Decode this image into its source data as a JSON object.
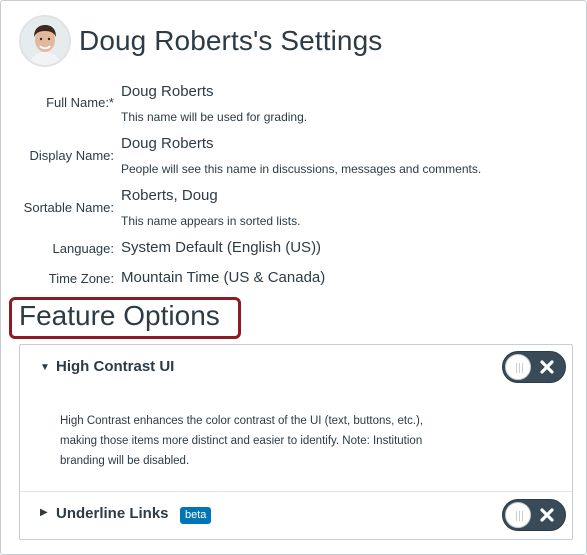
{
  "header": {
    "title": "Doug Roberts's Settings"
  },
  "profile": {
    "full_name": {
      "label": "Full Name:*",
      "value": "Doug Roberts",
      "hint": "This name will be used for grading."
    },
    "display_name": {
      "label": "Display Name:",
      "value": "Doug Roberts",
      "hint": "People will see this name in discussions, messages and comments."
    },
    "sortable_name": {
      "label": "Sortable Name:",
      "value": "Roberts, Doug",
      "hint": "This name appears in sorted lists."
    },
    "language": {
      "label": "Language:",
      "value": "System Default (English (US))"
    },
    "time_zone": {
      "label": "Time Zone:",
      "value": "Mountain Time (US & Canada)"
    }
  },
  "features": {
    "title": "Feature Options",
    "items": [
      {
        "name": "High Contrast UI",
        "expanded": true,
        "enabled": false,
        "description": "High Contrast enhances the color contrast of the UI (text, buttons, etc.), making those items more distinct and easier to identify. Note: Institution branding will be disabled."
      },
      {
        "name": "Underline Links",
        "badge": "beta",
        "expanded": false,
        "enabled": false
      }
    ]
  },
  "colors": {
    "text": "#2d3b45",
    "toggle_off": "#394b58",
    "badge": "#0374b5",
    "highlight_border": "#8c1b26"
  }
}
